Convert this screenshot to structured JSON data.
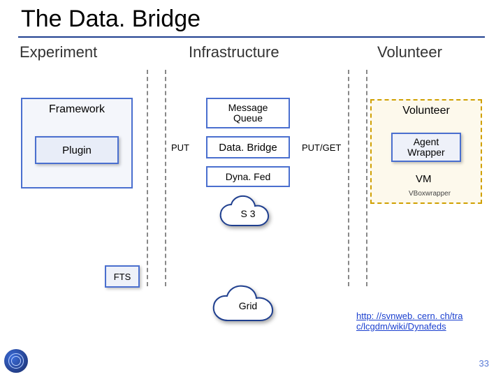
{
  "title": "The Data. Bridge",
  "columns": {
    "left": "Experiment",
    "mid": "Infrastructure",
    "right": "Volunteer"
  },
  "framework": {
    "label": "Framework",
    "plugin": "Plugin"
  },
  "infra": {
    "mq": "Message\nQueue",
    "db": "Data. Bridge",
    "dynafed": "Dyna. Fed",
    "s3": "S 3",
    "grid": "Grid",
    "fts": "FTS"
  },
  "edges": {
    "put": "PUT",
    "putget": "PUT/GET"
  },
  "volunteer": {
    "label": "Volunteer",
    "agent": "Agent\nWrapper",
    "vm": "VM",
    "vbox": "VBoxwrapper"
  },
  "link": "http: //svnweb. cern. ch/tra c/lcgdm/wiki/Dynafeds",
  "page": "33"
}
